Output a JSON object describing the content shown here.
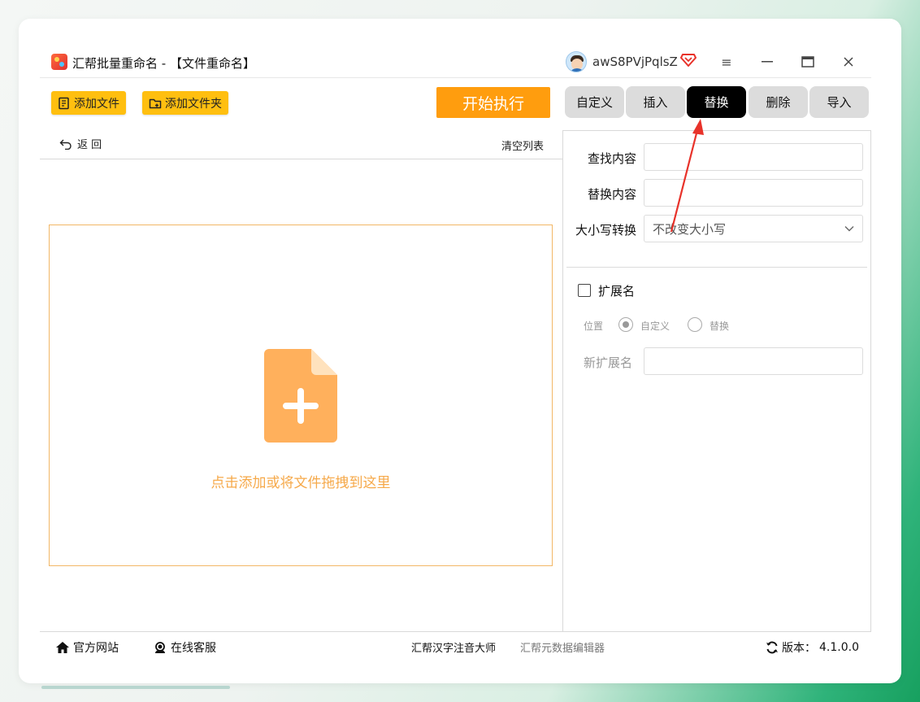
{
  "app": {
    "title": "汇帮批量重命名 - 【文件重命名】",
    "username": "awS8PVjPqlsZ"
  },
  "window_controls": {
    "menu": "≡",
    "minimize": "—",
    "maximize": "▭",
    "close": "✕"
  },
  "toolbar": {
    "add_file": "添加文件",
    "add_folder": "添加文件夹",
    "start": "开始执行"
  },
  "list_panel": {
    "back": "返 回",
    "clear": "清空列表",
    "drop_hint": "点击添加或将文件拖拽到这里"
  },
  "tabs": [
    {
      "label": "自定义",
      "active": false
    },
    {
      "label": "插入",
      "active": false
    },
    {
      "label": "替换",
      "active": true
    },
    {
      "label": "删除",
      "active": false
    },
    {
      "label": "导入",
      "active": false
    }
  ],
  "replace_form": {
    "find_label": "查找内容",
    "find_value": "",
    "replace_label": "替换内容",
    "replace_value": "",
    "case_label": "大小写转换",
    "case_selected": "不改变大小写"
  },
  "extension": {
    "checkbox_label": "扩展名",
    "checked": false,
    "position_label": "位置",
    "options": [
      {
        "label": "自定义",
        "checked": true
      },
      {
        "label": "替换",
        "checked": false
      }
    ],
    "new_ext_label": "新扩展名",
    "new_ext_value": ""
  },
  "footer": {
    "website": "官方网站",
    "support": "在线客服",
    "app1": "汇帮汉字注音大师",
    "app2": "汇帮元数据编辑器",
    "version_label": "版本：",
    "version": "4.1.0.0"
  },
  "colors": {
    "toolbar_yellow": "#ffbf10",
    "start_orange": "#ff9d0e",
    "drop_text": "#f6a94a",
    "active_tab": "#000000",
    "annotation_arrow": "#e8322a"
  }
}
